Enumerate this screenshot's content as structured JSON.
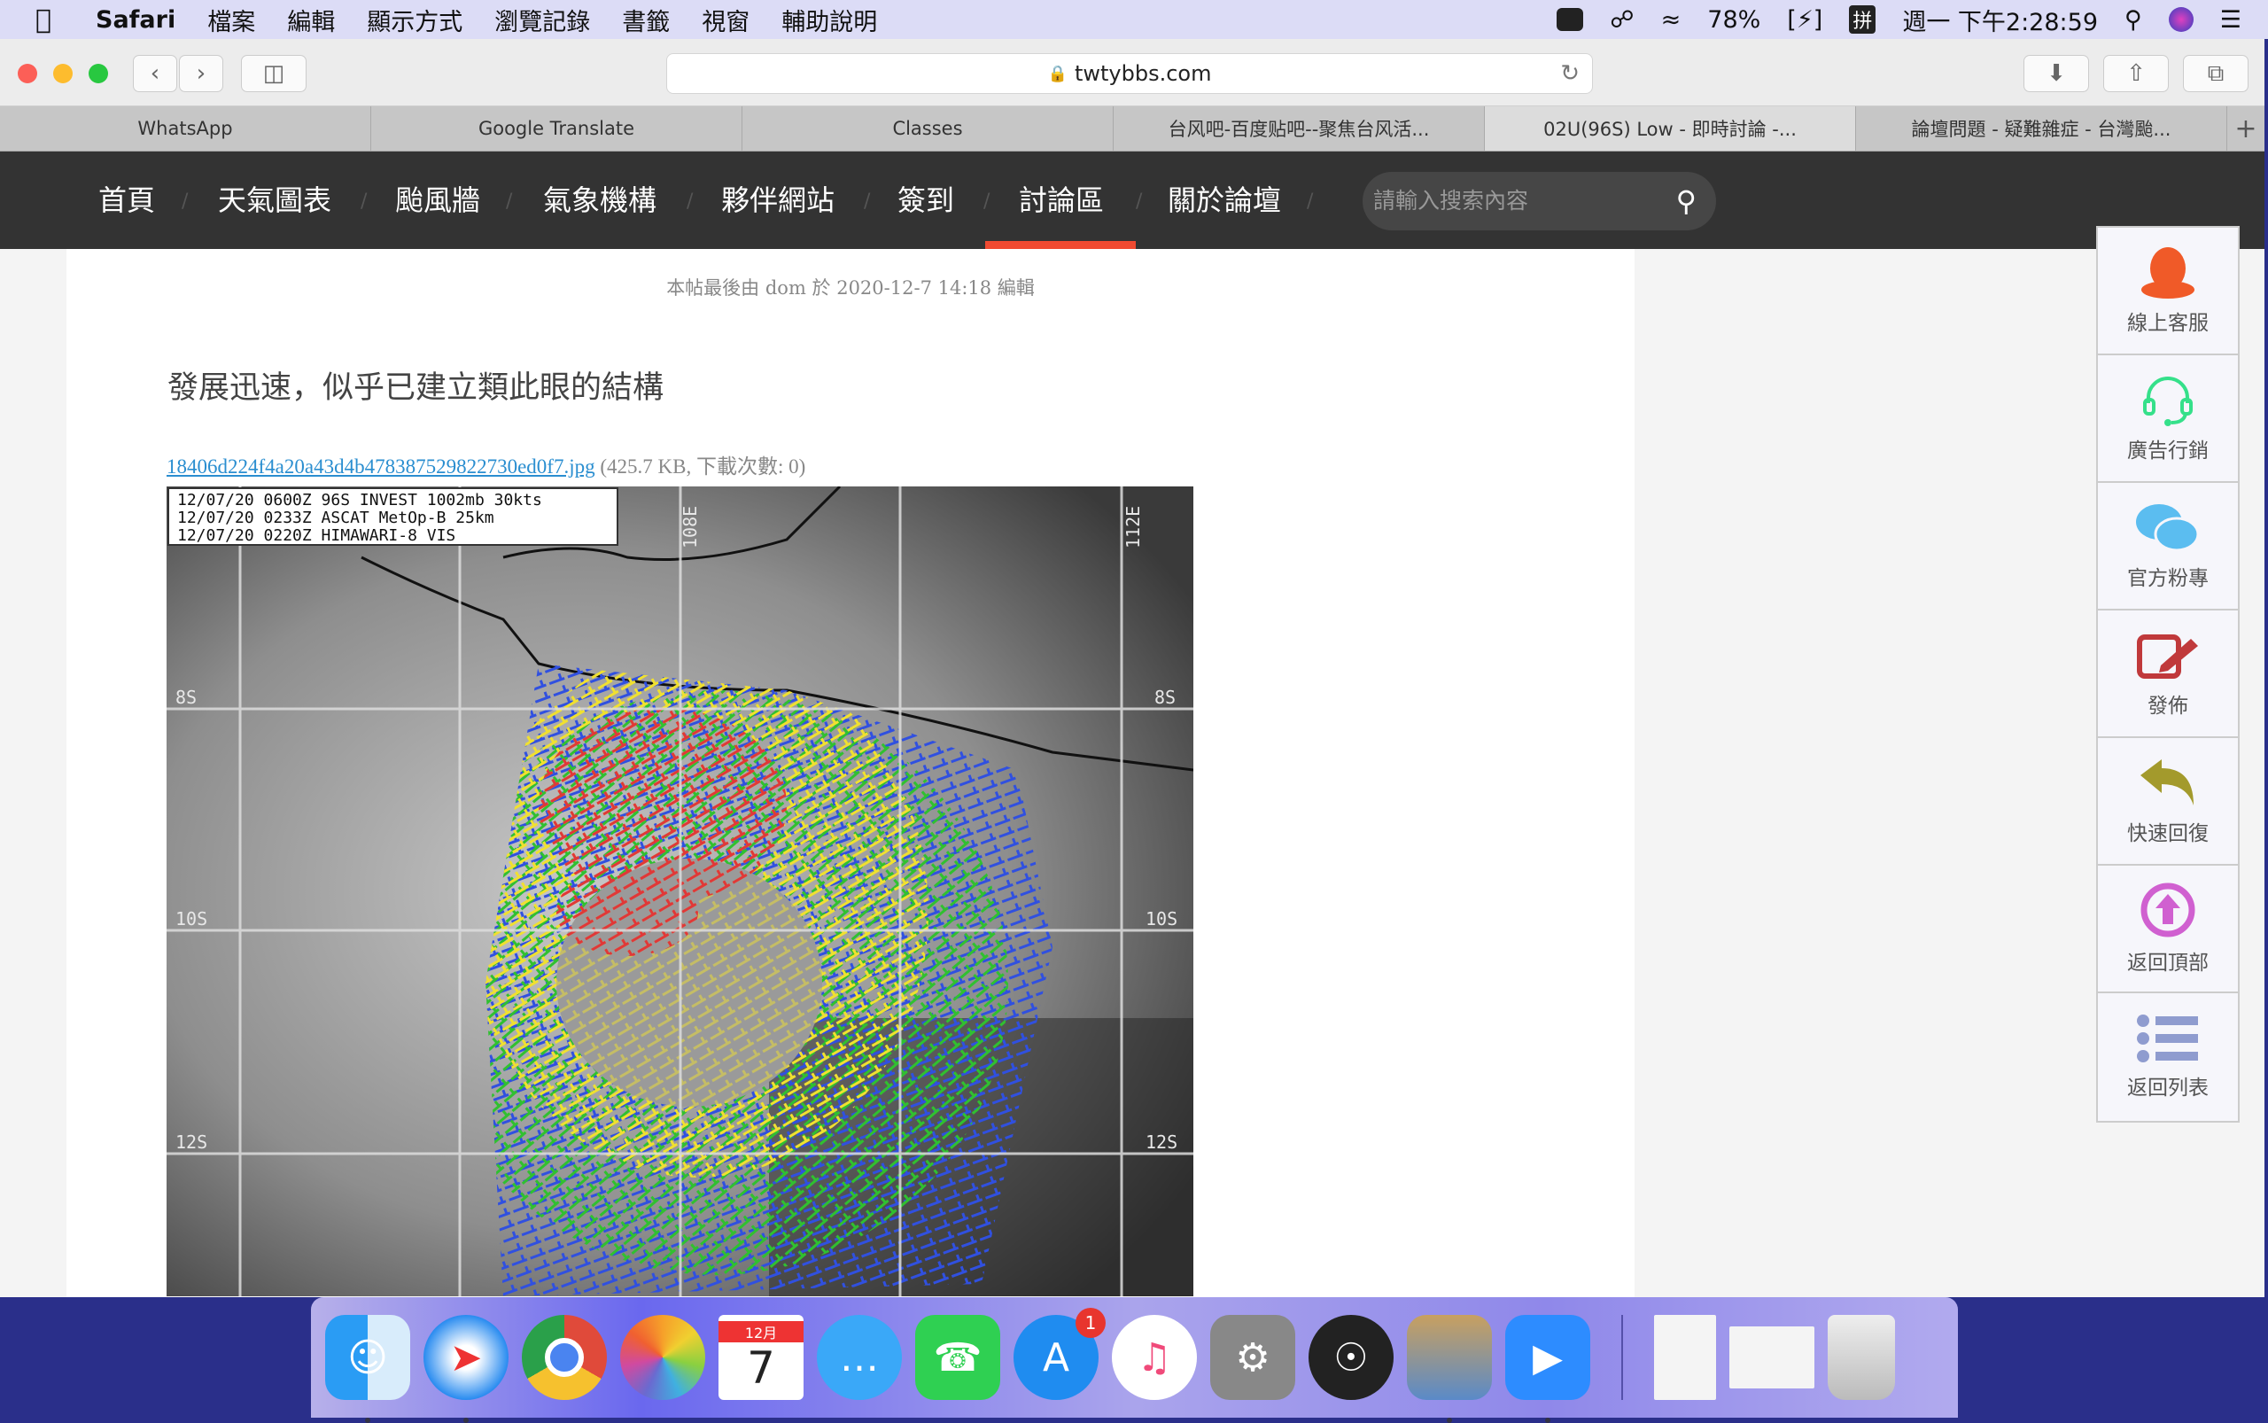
{
  "menubar": {
    "app": "Safari",
    "items": [
      "檔案",
      "編輯",
      "顯示方式",
      "瀏覽記錄",
      "書籤",
      "視窗",
      "輔助說明"
    ],
    "battery": "78%",
    "input_method": "拼",
    "clock": "週一 下午2:28:59"
  },
  "toolbar": {
    "url": "twtybbs.com"
  },
  "tabs": [
    {
      "label": "WhatsApp"
    },
    {
      "label": "Google Translate"
    },
    {
      "label": "Classes"
    },
    {
      "label": "台风吧-百度贴吧--聚焦台风活..."
    },
    {
      "label": "02U(96S) Low - 即時討論 -..."
    },
    {
      "label": "論壇問題 - 疑難雜症 - 台灣颱..."
    }
  ],
  "nav": {
    "items": [
      "首頁",
      "天氣圖表",
      "颱風牆",
      "氣象機構",
      "夥伴網站",
      "簽到",
      "討論區",
      "關於論壇"
    ],
    "active": "討論區",
    "search_placeholder": "請輸入搜索內容"
  },
  "post": {
    "meta": "本帖最後由 dom 於 2020-12-7 14:18 編輯",
    "title": "發展迅速，似乎已建立類此眼的結構",
    "attachment_name": "18406d224f4a20a43d4b478387529822730ed0f7.jpg",
    "attachment_info": "(425.7 KB, 下載次數: 0)"
  },
  "image": {
    "caption": [
      "12/07/20 0600Z   96S INVEST 1002mb 30kts",
      "12/07/20 0233Z   ASCAT MetOp-B 25km",
      "12/07/20 0220Z   HIMAWARI-8 VIS"
    ],
    "lat_labels": [
      "8S",
      "10S",
      "12S"
    ],
    "lon_labels": [
      "108E",
      "112E"
    ]
  },
  "sidebar": [
    {
      "label": "線上客服",
      "icon": "qq-penguin-icon",
      "color": "#f05a28"
    },
    {
      "label": "廣告行銷",
      "icon": "headset-icon",
      "color": "#35e08a"
    },
    {
      "label": "官方粉專",
      "icon": "wechat-icon",
      "color": "#5bbdf0"
    },
    {
      "label": "發佈",
      "icon": "edit-icon",
      "color": "#c0393b"
    },
    {
      "label": "快速回復",
      "icon": "reply-icon",
      "color": "#a39a2c"
    },
    {
      "label": "返回頂部",
      "icon": "back-to-top-icon",
      "color": "#d060d0"
    },
    {
      "label": "返回列表",
      "icon": "list-icon",
      "color": "#8f9ccf"
    }
  ],
  "dock": {
    "calendar_month": "12月",
    "calendar_day": "7",
    "appstore_badge": "1"
  }
}
